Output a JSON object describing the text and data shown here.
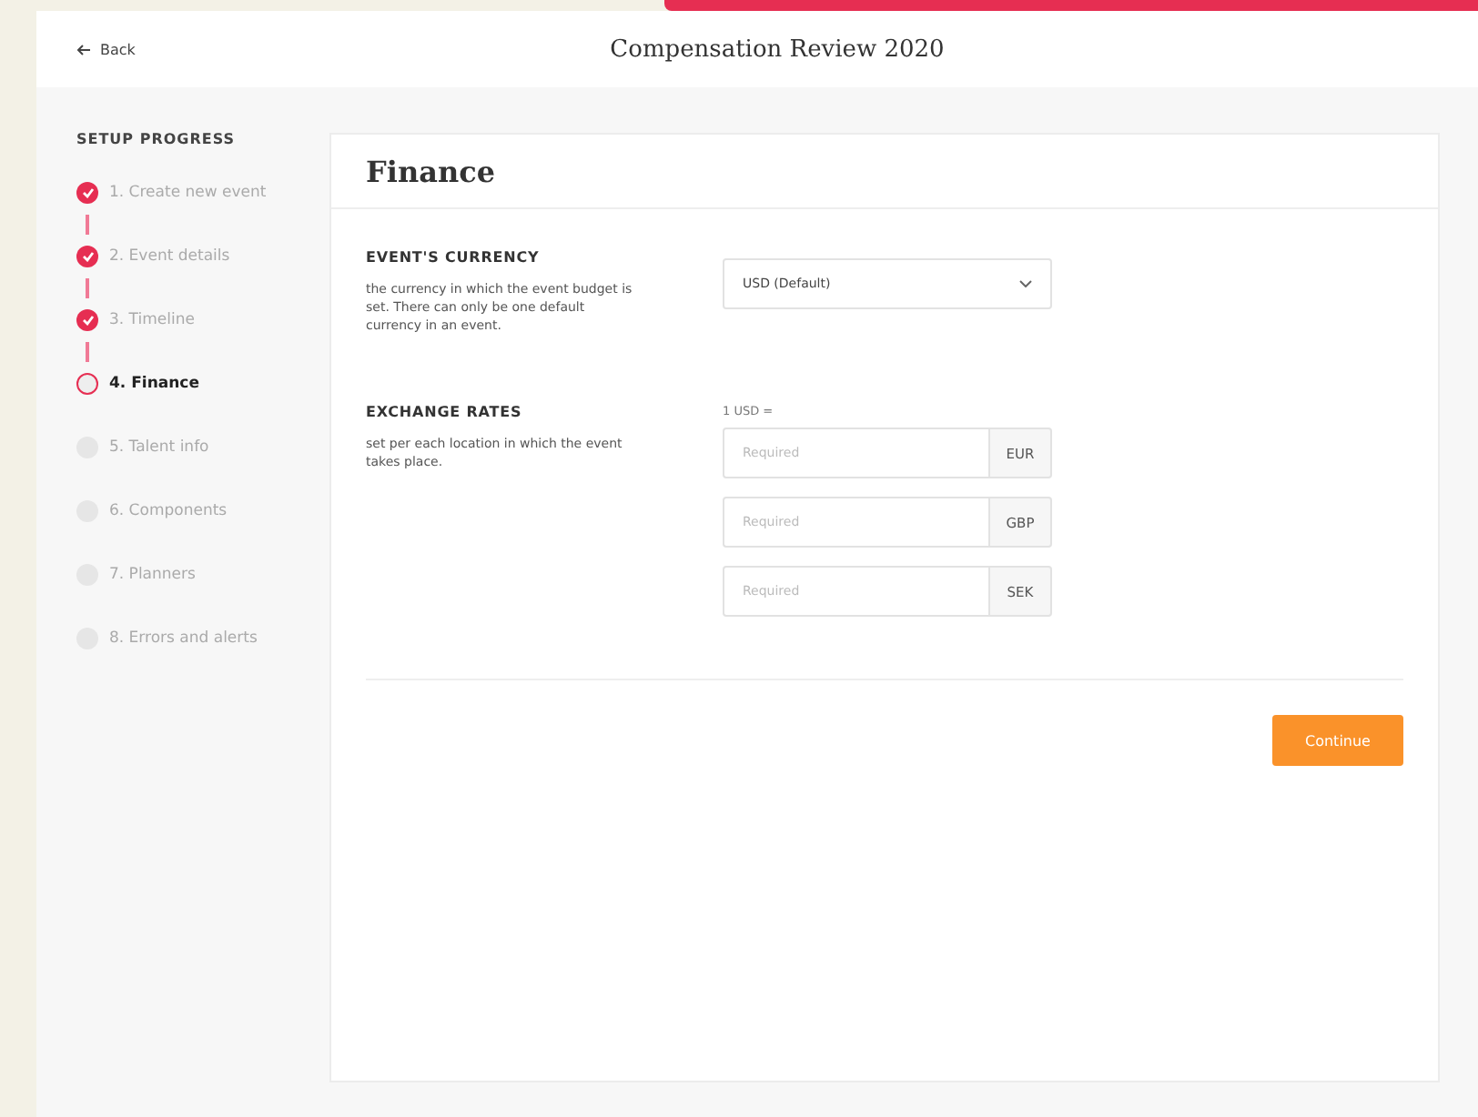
{
  "header": {
    "back": "Back",
    "title": "Compensation Review 2020"
  },
  "sidebar": {
    "heading": "SETUP PROGRESS",
    "steps": [
      {
        "label": "1. Create new event",
        "completed": true,
        "selected": false
      },
      {
        "label": "2. Event details",
        "completed": true,
        "selected": false
      },
      {
        "label": "3. Timeline",
        "completed": true,
        "selected": false
      },
      {
        "label": "4. Finance",
        "completed": false,
        "selected": true
      },
      {
        "label": "5. Talent info",
        "completed": false,
        "selected": false
      },
      {
        "label": "6. Components",
        "completed": false,
        "selected": false
      },
      {
        "label": "7. Planners",
        "completed": false,
        "selected": false
      },
      {
        "label": "8. Errors and alerts",
        "completed": false,
        "selected": false
      }
    ]
  },
  "card": {
    "title": "Finance",
    "currency": {
      "heading": "EVENT'S CURRENCY",
      "description": "the currency in which the event budget is set. There can only be one default currency in an event.",
      "value": "USD (Default)"
    },
    "exchange": {
      "heading": "EXCHANGE RATES",
      "description": "set per each location in which the event takes place.",
      "base": "1 USD =",
      "rates": [
        {
          "placeholder": "Required",
          "currency": "EUR"
        },
        {
          "placeholder": "Required",
          "currency": "GBP"
        },
        {
          "placeholder": "Required",
          "currency": "SEK"
        }
      ]
    },
    "button": "Continue"
  }
}
